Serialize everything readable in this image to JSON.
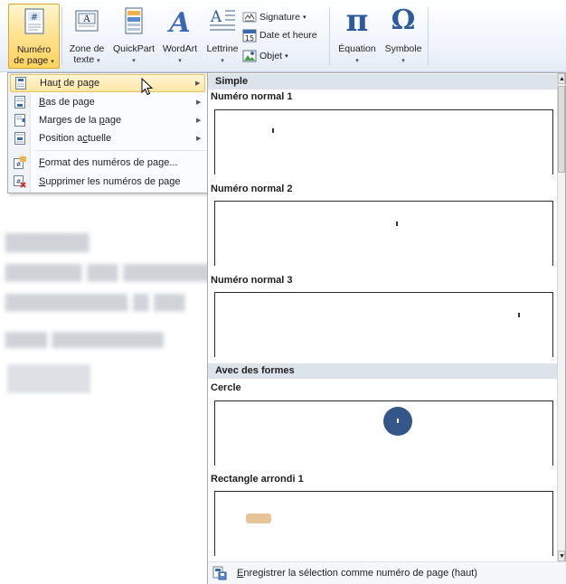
{
  "ribbon": {
    "numero_label_l1": "Numéro",
    "numero_label_l2": "de page",
    "zone_label_l1": "Zone de",
    "zone_label_l2": "texte",
    "quickpart_label": "QuickPart",
    "wordart_label": "WordArt",
    "lettrine_label": "Lettrine",
    "signature_label": "Signature",
    "date_label": "Date et heure",
    "objet_label": "Objet",
    "equation_label": "Équation",
    "symbole_label": "Symbole",
    "pi_glyph": "π",
    "omega_glyph": "Ω",
    "dropdown_arrow": "▾"
  },
  "menu": {
    "items": [
      {
        "label_pre": "Hau",
        "label_key": "t",
        "label_post": " de page",
        "icon": "page-top-icon",
        "has_submenu": true
      },
      {
        "label_pre": "",
        "label_key": "B",
        "label_post": "as de page",
        "icon": "page-bottom-icon",
        "has_submenu": true
      },
      {
        "label_pre": "Marges de la ",
        "label_key": "p",
        "label_post": "age",
        "icon": "page-margins-icon",
        "has_submenu": true
      },
      {
        "label_pre": "Position a",
        "label_key": "c",
        "label_post": "tuelle",
        "icon": "current-position-icon",
        "has_submenu": true
      },
      {
        "label_pre": "",
        "label_key": "F",
        "label_post": "ormat des numéros de page...",
        "icon": "format-page-number-icon",
        "has_submenu": false
      },
      {
        "label_pre": "",
        "label_key": "S",
        "label_post": "upprimer les numéros de page",
        "icon": "remove-page-number-icon",
        "has_submenu": false
      }
    ],
    "submenu_arrow": "▶"
  },
  "gallery": {
    "section_simple": "Simple",
    "section_shapes": "Avec des formes",
    "items": [
      {
        "title": "Numéro normal 1",
        "style": "plain-left"
      },
      {
        "title": "Numéro normal 2",
        "style": "plain-center"
      },
      {
        "title": "Numéro normal 3",
        "style": "plain-right"
      },
      {
        "title": "Cercle",
        "style": "circle"
      },
      {
        "title": "Rectangle arrondi 1",
        "style": "rounded-rectangle"
      }
    ],
    "footer_pre": "",
    "footer_key": "E",
    "footer_post": "nregistrer la sélection comme numéro de page (haut)",
    "scroll_up": "▲",
    "scroll_down": "▼"
  },
  "colors": {
    "active_button": "#ffd35c",
    "menu_highlight": "#ffe7a3",
    "gallery_header": "#dde3ea",
    "circle_fill": "#35568a",
    "rounded_rect_fill": "#e7c39a"
  }
}
